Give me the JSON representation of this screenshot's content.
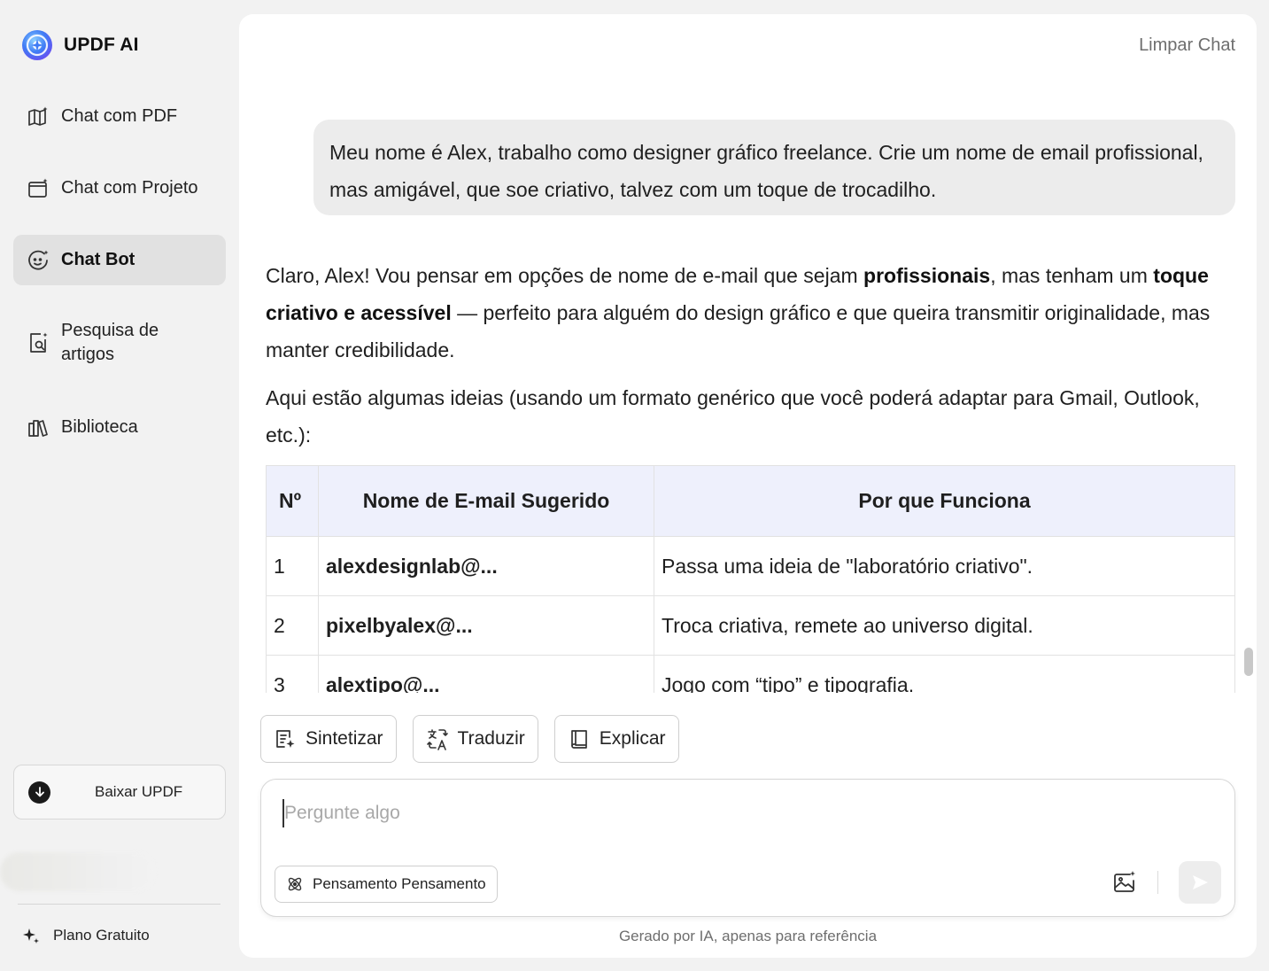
{
  "brand": {
    "name": "UPDF AI",
    "icon": "updf-ai-logo"
  },
  "sidebar": {
    "items": [
      {
        "label": "Chat com PDF",
        "icon": "pdf-chat-icon",
        "active": false
      },
      {
        "label": "Chat com Projeto",
        "icon": "folder-chat-icon",
        "active": false
      },
      {
        "label": "Chat Bot",
        "icon": "chatbot-icon",
        "active": true
      },
      {
        "label": "Pesquisa de artigos",
        "icon": "article-search-icon",
        "active": false
      },
      {
        "label": "Biblioteca",
        "icon": "library-icon",
        "active": false
      }
    ],
    "download_label": "Baixar UPDF",
    "plan_label": "Plano Gratuito"
  },
  "header": {
    "clear_chat": "Limpar Chat"
  },
  "conversation": {
    "user_message": "Meu nome é Alex, trabalho como designer gráfico freelance. Crie um nome de email profissional, mas amigável, que soe criativo, talvez com um toque de trocadilho.",
    "bot_p1_a": "Claro, Alex! Vou pensar em opções de nome de e-mail que sejam ",
    "bot_p1_b": "profissionais",
    "bot_p1_c": ", mas tenham um ",
    "bot_p1_d": "toque criativo e acessível",
    "bot_p1_e": " — perfeito para alguém do design gráfico e que queira transmitir originalidade, mas manter credibilidade.",
    "bot_p2": "Aqui estão algumas ideias (usando um formato genérico que você poderá adaptar para Gmail, Outlook, etc.):",
    "table": {
      "headers": [
        "Nº",
        "Nome de E-mail Sugerido",
        "Por que Funciona"
      ],
      "rows": [
        [
          "1",
          "alexdesignlab@...",
          "Passa uma ideia de \"laboratório criativo\"."
        ],
        [
          "2",
          "pixelbyalex@...",
          "Troca criativa, remete ao universo digital."
        ],
        [
          "3",
          "alextipo@...",
          "Jogo com “tipo” e tipografia."
        ]
      ]
    }
  },
  "quick_actions": [
    {
      "label": "Sintetizar",
      "icon": "summarize-icon"
    },
    {
      "label": "Traduzir",
      "icon": "translate-icon"
    },
    {
      "label": "Explicar",
      "icon": "explain-book-icon"
    }
  ],
  "input": {
    "placeholder": "Pergunte algo",
    "thinking_label": "Pensamento Pensamento"
  },
  "footer": {
    "disclaimer": "Gerado por IA, apenas para referência"
  }
}
